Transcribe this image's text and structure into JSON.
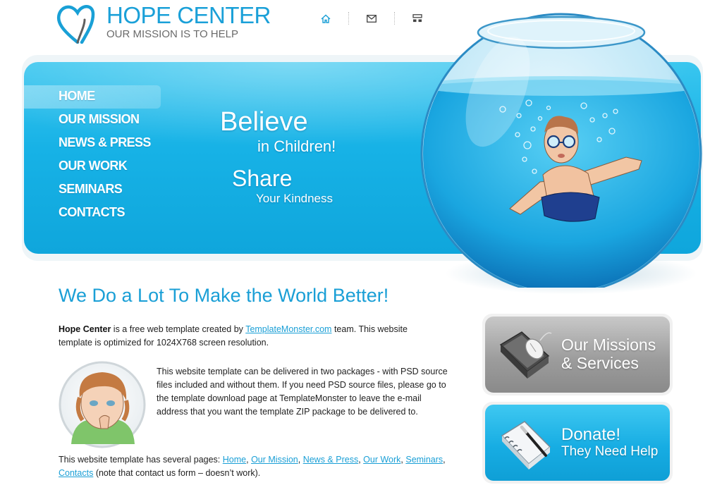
{
  "header": {
    "title": "HOPE CENTER",
    "subtitle": "OUR MISSION IS TO HELP",
    "icons": [
      "home-icon",
      "mail-icon",
      "sitemap-icon"
    ]
  },
  "nav": {
    "items": [
      {
        "label": "HOME"
      },
      {
        "label": "OUR MISSION"
      },
      {
        "label": "NEWS & PRESS"
      },
      {
        "label": "OUR WORK"
      },
      {
        "label": "SEMINARS"
      },
      {
        "label": "CONTACTS"
      }
    ],
    "active": "HOME"
  },
  "banner": {
    "line1": "Believe",
    "line2": "in Children!",
    "line3": "Share",
    "line4": "Your Kindness"
  },
  "content": {
    "heading": "We Do a Lot To Make the World Better!",
    "p1_bold": "Hope Center",
    "p1_a": " is a free web template created by ",
    "p1_link": "TemplateMonster.com",
    "p1_b": " team. This website template is optimized for 1024X768 screen resolution.",
    "p2": "This website template can be delivered in two packages - with PSD source files included and without them. If you need PSD source files, please go to the template download page at TemplateMonster to leave the e-mail address that you want the template ZIP package to be delivered to.",
    "p3_a": "This website template has several pages: ",
    "p3_links": [
      "Home",
      "Our Mission",
      "News & Press",
      "Our Work",
      "Seminars",
      "Contacts"
    ],
    "p3_sep": ", ",
    "p3_b": " (note that contact us form – doesn’t work)."
  },
  "sidebar": {
    "missions_line1": "Our Missions",
    "missions_line2": "& Services",
    "donate_line1": "Donate!",
    "donate_line2": "They Need Help"
  },
  "colors": {
    "accent": "#1a9fd6",
    "banner": "#17b2e6",
    "gray_box": "#9d9d9d"
  }
}
